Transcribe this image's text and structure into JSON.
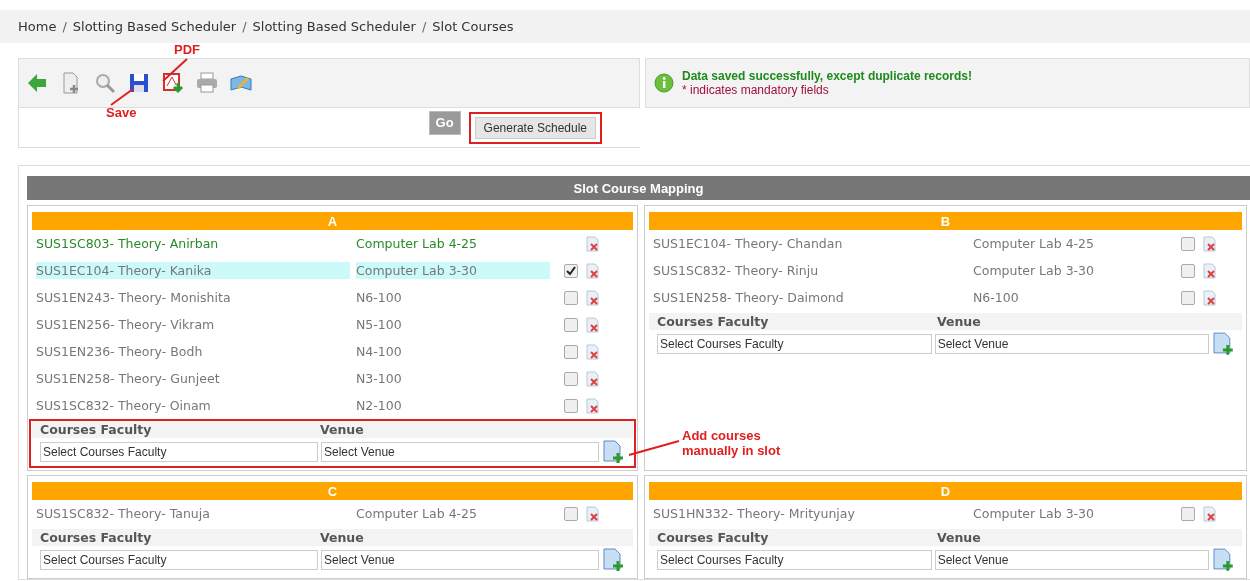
{
  "breadcrumb": {
    "separator": "/",
    "items": [
      "Home",
      "Slotting Based Scheduler",
      "Slotting Based Scheduler",
      "Slot Courses"
    ]
  },
  "callouts": [
    {
      "kind": "pdf",
      "text": "PDF"
    },
    {
      "kind": "save",
      "text": "Save"
    },
    {
      "kind": "add",
      "text": "Add courses manually in slot"
    }
  ],
  "message": {
    "text": "Data saved successfully, except duplicate records!",
    "note": "* indicates mandatory fields"
  },
  "actions": {
    "go": {
      "label": "Go",
      "disabled": true
    },
    "generate": {
      "label": "Generate Schedule",
      "highlighted": true
    }
  },
  "panel_title": "Slot Course Mapping",
  "slots": [
    {
      "name": "A",
      "highlighted": true,
      "faculty_label": "Courses Faculty",
      "venue_label": "Venue",
      "faculty_placeholder": "Select Courses Faculty",
      "venue_placeholder": "Select Venue",
      "rows": [
        {
          "kind": "saved",
          "course": "SUS1SC803- Theory- Anirban",
          "venue": "Computer Lab 4-25",
          "selected": false
        },
        {
          "kind": "pending",
          "course": "SUS1EC104- Theory- Kanika",
          "venue": "Computer Lab 3-30",
          "selected": true,
          "checked": true
        },
        {
          "kind": "pending",
          "course": "SUS1EN243- Theory- Monishita",
          "venue": "N6-100",
          "selected": false,
          "checked": false
        },
        {
          "kind": "pending",
          "course": "SUS1EN256- Theory- Vikram",
          "venue": "N5-100",
          "selected": false,
          "checked": false
        },
        {
          "kind": "pending",
          "course": "SUS1EN236- Theory- Bodh",
          "venue": "N4-100",
          "selected": false,
          "checked": false
        },
        {
          "kind": "pending",
          "course": "SUS1EN258- Theory- Gunjeet",
          "venue": "N3-100",
          "selected": false,
          "checked": false
        },
        {
          "kind": "pending",
          "course": "SUS1SC832- Theory- Oinam",
          "venue": "N2-100",
          "selected": false,
          "checked": false
        }
      ]
    },
    {
      "name": "B",
      "highlighted": false,
      "faculty_label": "Courses Faculty",
      "venue_label": "Venue",
      "faculty_placeholder": "Select Courses Faculty",
      "venue_placeholder": "Select Venue",
      "rows": [
        {
          "kind": "pending",
          "course": "SUS1EC104- Theory- Chandan",
          "venue": "Computer Lab 4-25",
          "selected": false,
          "checked": false
        },
        {
          "kind": "pending",
          "course": "SUS1SC832- Theory- Rinju",
          "venue": "Computer Lab 3-30",
          "selected": false,
          "checked": false
        },
        {
          "kind": "pending",
          "course": "SUS1EN258- Theory- Daimond",
          "venue": "N6-100",
          "selected": false,
          "checked": false
        }
      ]
    },
    {
      "name": "C",
      "highlighted": false,
      "faculty_label": "Courses Faculty",
      "venue_label": "Venue",
      "faculty_placeholder": "Select Courses Faculty",
      "venue_placeholder": "Select Venue",
      "rows": [
        {
          "kind": "pending",
          "course": "SUS1SC832- Theory- Tanuja",
          "venue": "Computer Lab 4-25",
          "selected": false,
          "checked": false
        }
      ]
    },
    {
      "name": "D",
      "highlighted": false,
      "faculty_label": "Courses Faculty",
      "venue_label": "Venue",
      "faculty_placeholder": "Select Courses Faculty",
      "venue_placeholder": "Select Venue",
      "rows": [
        {
          "kind": "pending",
          "course": "SUS1HN332- Theory- Mrityunjay",
          "venue": "Computer Lab 3-30",
          "selected": false,
          "checked": false
        }
      ]
    }
  ]
}
